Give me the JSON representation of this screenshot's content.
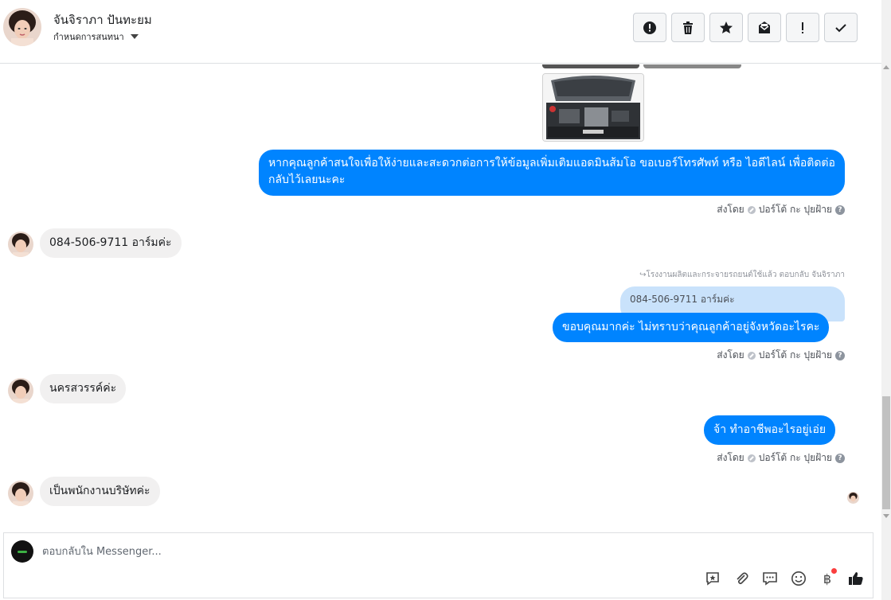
{
  "header": {
    "name": "จันจิราภา ปันทะยม",
    "assign_label": "กำหนดการสนทนา",
    "toolbar": [
      {
        "name": "mark-spam-button",
        "icon": "alert-circle-icon"
      },
      {
        "name": "delete-button",
        "icon": "trash-icon"
      },
      {
        "name": "star-button",
        "icon": "star-icon"
      },
      {
        "name": "mark-unread-button",
        "icon": "envelope-icon"
      },
      {
        "name": "follow-up-button",
        "icon": "exclamation-icon"
      },
      {
        "name": "mark-done-button",
        "icon": "check-icon"
      }
    ]
  },
  "messages": {
    "m1": "หากคุณลูกค้าสนใจเพื่อให้ง่ายและสะดวกต่อการให้ข้อมูลเพิ่มเติมแอดมินส้มโอ ขอเบอร์โทรศัพท์ หรือ ไอดีไลน์ เพื่อติดต่อกลับไว้เลยนะคะ",
    "sent1": "ส่งโดย",
    "sender1": "ปอร์โต้ กะ ปุยฝ้าย",
    "m2": "084-506-9711 อาร์มค่ะ",
    "reply_note": "โรงงานผลิตและกระจายรถยนต์ใช้แล้ว ตอบกลับ จันจิราภา",
    "quoted": "084-506-9711 อาร์มค่ะ",
    "m3": "ขอบคุณมากค่ะ ไม่ทราบว่าคุณลูกค้าอยู่จังหวัดอะไรคะ",
    "sent2": "ส่งโดย",
    "sender2": "ปอร์โต้ กะ ปุยฝ้าย",
    "m4": "นครสวรรค์ค่ะ",
    "m5": "จ้า ทำอาชีพอะไรอยู่เอ่ย",
    "sent3": "ส่งโดย",
    "sender3": "ปอร์โต้ กะ ปุยฝ้าย",
    "m6": "เป็นพนักงานบริษัทค่ะ"
  },
  "composer": {
    "placeholder": "ตอบกลับใน Messenger...",
    "baht_symbol": "฿"
  },
  "colors": {
    "outgoing": "#0084ff",
    "incoming": "#f1f0f0",
    "quote": "#c9e2fb"
  }
}
